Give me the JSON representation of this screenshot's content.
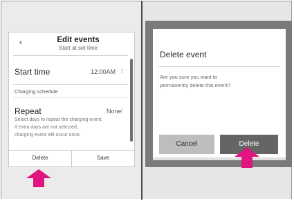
{
  "left_screen": {
    "back_icon": "chevron-left-icon",
    "back_glyph": "‹",
    "title": "Edit events",
    "subtitle": "Start at set time",
    "start_time": {
      "label": "Start time",
      "value": "12:00AM",
      "more_glyph": "⁝"
    },
    "section_label": "Charging schedule",
    "repeat": {
      "label": "Repeat",
      "value": "None",
      "more_glyph": "⁝",
      "hint_line1": "Select days to repeat the charging event.",
      "hint_line2": "If extra days are not selected,",
      "hint_line3": "charging event will occur once."
    },
    "buttons": {
      "delete": "Delete",
      "save": "Save"
    }
  },
  "right_screen": {
    "dialog": {
      "title": "Delete event",
      "message_line1": "Are you sure you want to",
      "message_line2": "permanently delete this event?",
      "cancel": "Cancel",
      "delete": "Delete"
    }
  },
  "colors": {
    "pointer_arrow": "#e0157f",
    "delete_button_bg": "#656565",
    "cancel_button_bg": "#bdbdbd",
    "overlay": "#7a7a7a"
  },
  "icons": {
    "pointer_arrow": "up-arrow-icon"
  }
}
